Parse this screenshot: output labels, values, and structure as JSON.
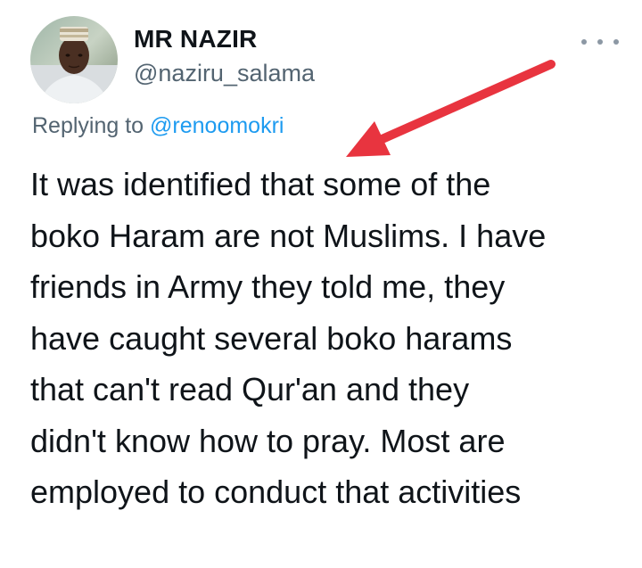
{
  "author": {
    "display_name": "MR NAZIR",
    "handle": "@naziru_salama"
  },
  "reply_context": {
    "prefix": "Replying to",
    "mention": "@renoomokri"
  },
  "tweet": {
    "lines": [
      "It was identified that some of the",
      "boko Haram are not Muslims. I have",
      "friends in Army they told me, they",
      "have caught several boko harams",
      "that can't read Qur'an and they",
      "didn't know how to pray. Most are",
      "employed to conduct that activities"
    ]
  },
  "icons": {
    "more": "more-horizontal-icon",
    "annotation": "red-arrow"
  },
  "colors": {
    "name": "#0f1419",
    "secondary": "#536471",
    "link": "#1d9bf0",
    "annotation_arrow": "#e8343f"
  }
}
